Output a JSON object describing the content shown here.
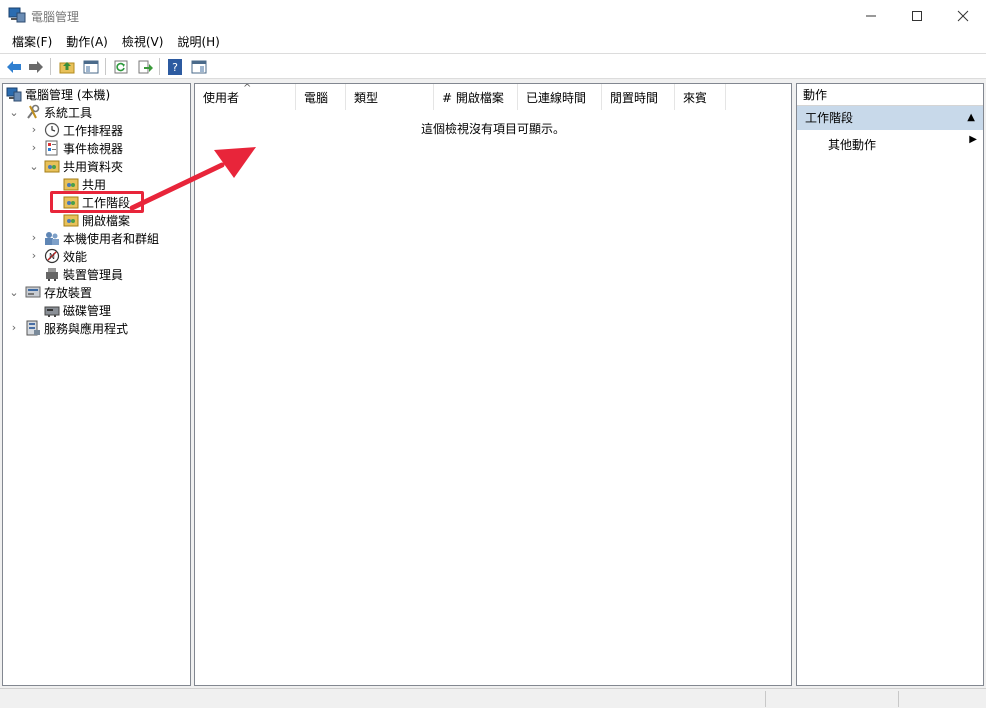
{
  "window": {
    "title": "電腦管理",
    "minimize_icon": "minimize-icon",
    "maximize_icon": "maximize-icon",
    "close_icon": "close-icon"
  },
  "menu": [
    "檔案(F)",
    "動作(A)",
    "檢視(V)",
    "說明(H)"
  ],
  "toolbar": {
    "buttons": [
      "back-arrow-icon",
      "forward-arrow-icon",
      "up-folder-icon",
      "show-hide-tree-icon",
      "refresh-icon",
      "export-list-icon",
      "help-icon",
      "show-hide-action-pane-icon"
    ]
  },
  "tree": {
    "root": "電腦管理 (本機)",
    "system_tools": "系統工具",
    "task_scheduler": "工作排程器",
    "event_viewer": "事件檢視器",
    "shared_folders": "共用資料夾",
    "shares": "共用",
    "sessions": "工作階段",
    "open_files": "開啟檔案",
    "local_users": "本機使用者和群組",
    "performance": "效能",
    "device_manager": "裝置管理員",
    "storage": "存放裝置",
    "disk_management": "磁碟管理",
    "services_apps": "服務與應用程式"
  },
  "list": {
    "columns": [
      "使用者",
      "電腦",
      "類型",
      "# 開啟檔案",
      "已連線時間",
      "閒置時間",
      "來賓"
    ],
    "sort_indicator": "^",
    "empty_message": "這個檢視沒有項目可顯示。"
  },
  "actions": {
    "header": "動作",
    "section": "工作階段",
    "item": "其他動作"
  },
  "annotation": {
    "highlight_color": "#e8253a"
  }
}
